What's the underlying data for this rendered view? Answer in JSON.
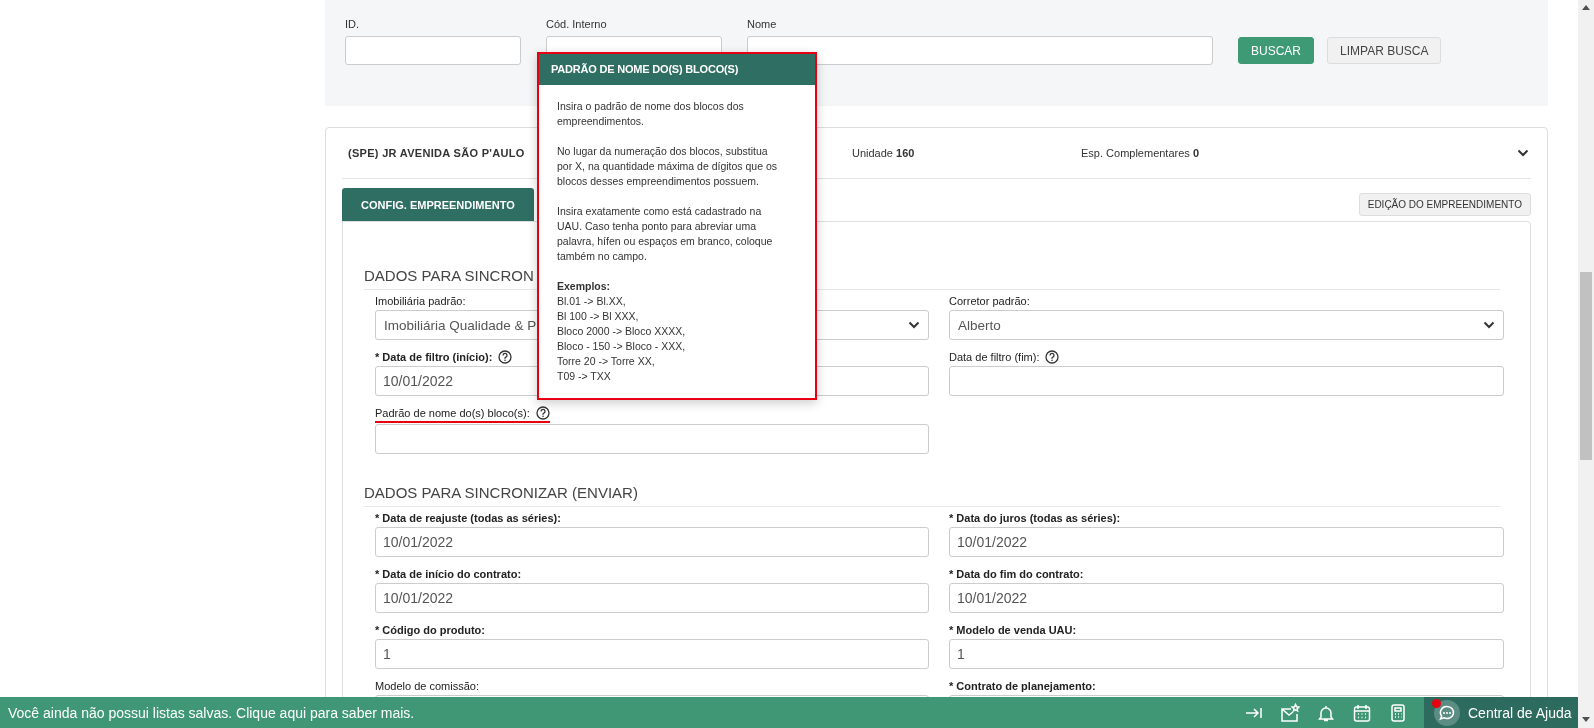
{
  "search": {
    "fields": [
      {
        "label": "ID."
      },
      {
        "label": "Cód. Interno"
      },
      {
        "label": "Nome"
      }
    ],
    "buttons": [
      {
        "label": "BUSCAR",
        "kind": "primary"
      },
      {
        "label": "LIMPAR BUSCA",
        "kind": "secondary"
      }
    ]
  },
  "project": {
    "name": "(SPE) JR AVENIDA SÃO P'AULO",
    "expanded": true,
    "stats": [
      {
        "label": "Unidade",
        "value": "160"
      },
      {
        "label": "Esp. Complementares",
        "value": "0"
      }
    ],
    "tabs": [
      {
        "label": "CONFIG. EMPREENDIMENTO",
        "selected": true
      }
    ],
    "edit_button": "EDIÇÃO DO EMPREENDIMENTO",
    "sections": [
      {
        "title": "DADOS PARA SINCRON",
        "rows": [
          [
            {
              "label": "Imobiliária padrão:",
              "kind": "select",
              "required": false,
              "value": "Imobiliária Qualidade & P"
            },
            {
              "label": "Corretor padrão:",
              "kind": "select",
              "required": false,
              "value": "Alberto"
            }
          ],
          [
            {
              "label": "* Data de filtro (início):",
              "kind": "text",
              "required": true,
              "help": true,
              "value": "10/01/2022"
            },
            {
              "label": "Data de filtro (fim):",
              "kind": "text",
              "required": false,
              "help": true
            }
          ],
          [
            {
              "label": "Padrão de nome do(s) bloco(s):",
              "kind": "text",
              "required": false,
              "help": true,
              "highlighted": true
            }
          ]
        ]
      },
      {
        "title": "DADOS PARA SINCRONIZAR (ENVIAR)",
        "rows": [
          [
            {
              "label": "* Data de reajuste (todas as séries):",
              "kind": "text",
              "required": true,
              "value": "10/01/2022"
            },
            {
              "label": "* Data do juros (todas as séries):",
              "kind": "text",
              "required": true,
              "value": "10/01/2022"
            }
          ],
          [
            {
              "label": "* Data de início do contrato:",
              "kind": "text",
              "required": true,
              "value": "10/01/2022"
            },
            {
              "label": "* Data do fim do contrato:",
              "kind": "text",
              "required": true,
              "value": "10/01/2022"
            }
          ],
          [
            {
              "label": "* Código do produto:",
              "kind": "text",
              "required": true,
              "value": "1"
            },
            {
              "label": "* Modelo de venda UAU:",
              "kind": "text",
              "required": true,
              "value": "1"
            }
          ],
          [
            {
              "label": "Modelo de comissão:",
              "kind": "text",
              "required": false
            },
            {
              "label": "* Contrato de planejamento:",
              "kind": "text",
              "required": true
            }
          ]
        ]
      }
    ]
  },
  "popover": {
    "title": "PADRÃO DE NOME DO(S) BLOCO(S)",
    "paragraphs": [
      "Insira o padrão de nome dos blocos dos empreendimentos.",
      "No lugar da numeração dos blocos, substitua por X, na quantidade máxima de dígitos que os blocos desses empreendimentos possuem.",
      "Insira exatamente como está cadastrado na UAU. Caso tenha ponto para abreviar uma palavra, hífen ou espaços em branco, coloque também no campo."
    ],
    "examples_title": "Exemplos:",
    "examples": [
      "Bl.01 -> Bl.XX,",
      "Bl 100 -> Bl XXX,",
      "Bloco 2000 -> Bloco XXXX,",
      "Bloco - 150 -> Bloco - XXX,",
      "Torre 20 -> Torre XX,",
      "T09 -> TXX"
    ]
  },
  "bottom_bar": {
    "message": "Você ainda não possui listas salvas. Clique aqui para saber mais.",
    "help_label": "Central de Ajuda",
    "unread": true
  }
}
